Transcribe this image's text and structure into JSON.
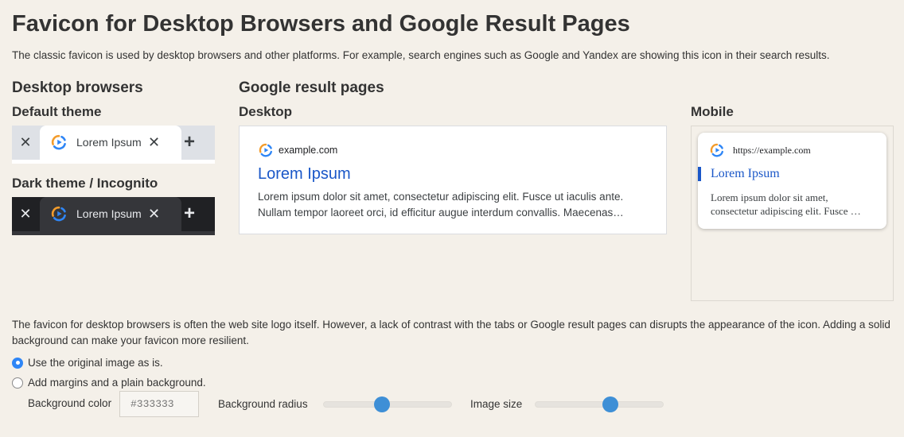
{
  "page": {
    "title": "Favicon for Desktop Browsers and Google Result Pages",
    "intro": "The classic favicon is used by desktop browsers and other platforms. For example, search engines such as Google and Yandex are showing this icon in their search results."
  },
  "desktop": {
    "heading": "Desktop browsers",
    "default_theme_label": "Default theme",
    "dark_theme_label": "Dark theme / Incognito",
    "tab_label": "Lorem Ipsum",
    "tab_close": "✕",
    "tab_new": "+"
  },
  "google": {
    "heading": "Google result pages",
    "desktop_label": "Desktop",
    "mobile_label": "Mobile",
    "desktop_result": {
      "url": "example.com",
      "title": "Lorem Ipsum",
      "snippet": "Lorem ipsum dolor sit amet, consectetur adipiscing elit. Fusce ut iaculis ante. Nullam tempor laoreet orci, id efficitur augue interdum convallis. Maecenas…"
    },
    "mobile_result": {
      "url": "https://example.com",
      "title": "Lorem Ipsum",
      "snippet": "Lorem ipsum dolor sit amet, consectetur adipiscing elit. Fusce …"
    }
  },
  "settings": {
    "description": "The favicon for desktop browsers is often the web site logo itself. However, a lack of contrast with the tabs or Google result pages can disrupts the appearance of the icon. Adding a solid background can make your favicon more resilient.",
    "options": [
      {
        "label": "Use the original image as is.",
        "checked": true
      },
      {
        "label": "Add margins and a plain background.",
        "checked": false
      }
    ],
    "background_color_label": "Background color",
    "background_color_placeholder": "#333333",
    "background_radius_label": "Background radius",
    "background_radius_value": 0.45,
    "image_size_label": "Image size",
    "image_size_value": 0.6
  },
  "colors": {
    "page_bg": "#f4f0e9",
    "link_blue": "#1a57c8",
    "accent_blue": "#2f86f6",
    "favicon_orange": "#f39c2c",
    "favicon_blue": "#2f86f6"
  }
}
